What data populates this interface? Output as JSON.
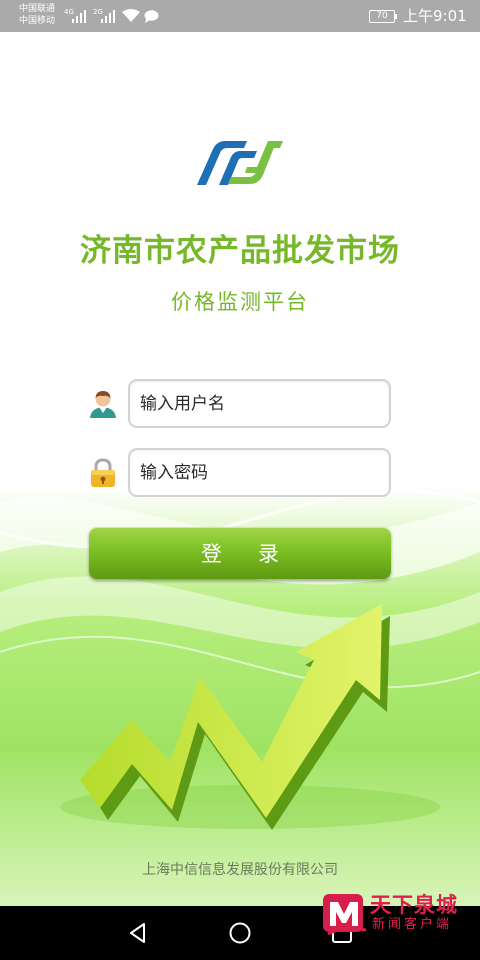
{
  "status_bar": {
    "carrier_1": "中国联通",
    "carrier_2": "中国移动",
    "sim1_network": "4G",
    "sim2_network": "2G",
    "battery": "70",
    "time": "上午9:01"
  },
  "app": {
    "title": "济南市农产品批发市场",
    "subtitle": "价格监测平台"
  },
  "login": {
    "username_placeholder": "输入用户名",
    "password_placeholder": "输入密码",
    "login_label": "登录"
  },
  "footer": {
    "company": "上海中信信息发展股份有限公司"
  },
  "watermark": {
    "name": "天下泉城",
    "subtitle": "新闻客户端"
  },
  "icons": {
    "user": "user-icon",
    "password": "lock-icon",
    "back": "back-icon",
    "home": "home-icon",
    "recents": "recents-icon"
  },
  "colors": {
    "accent_green": "#76b82a",
    "button_green": "#7cbf24",
    "logo_blue": "#1e6fb6",
    "logo_green": "#7ac143",
    "watermark_red": "#e0204c"
  }
}
